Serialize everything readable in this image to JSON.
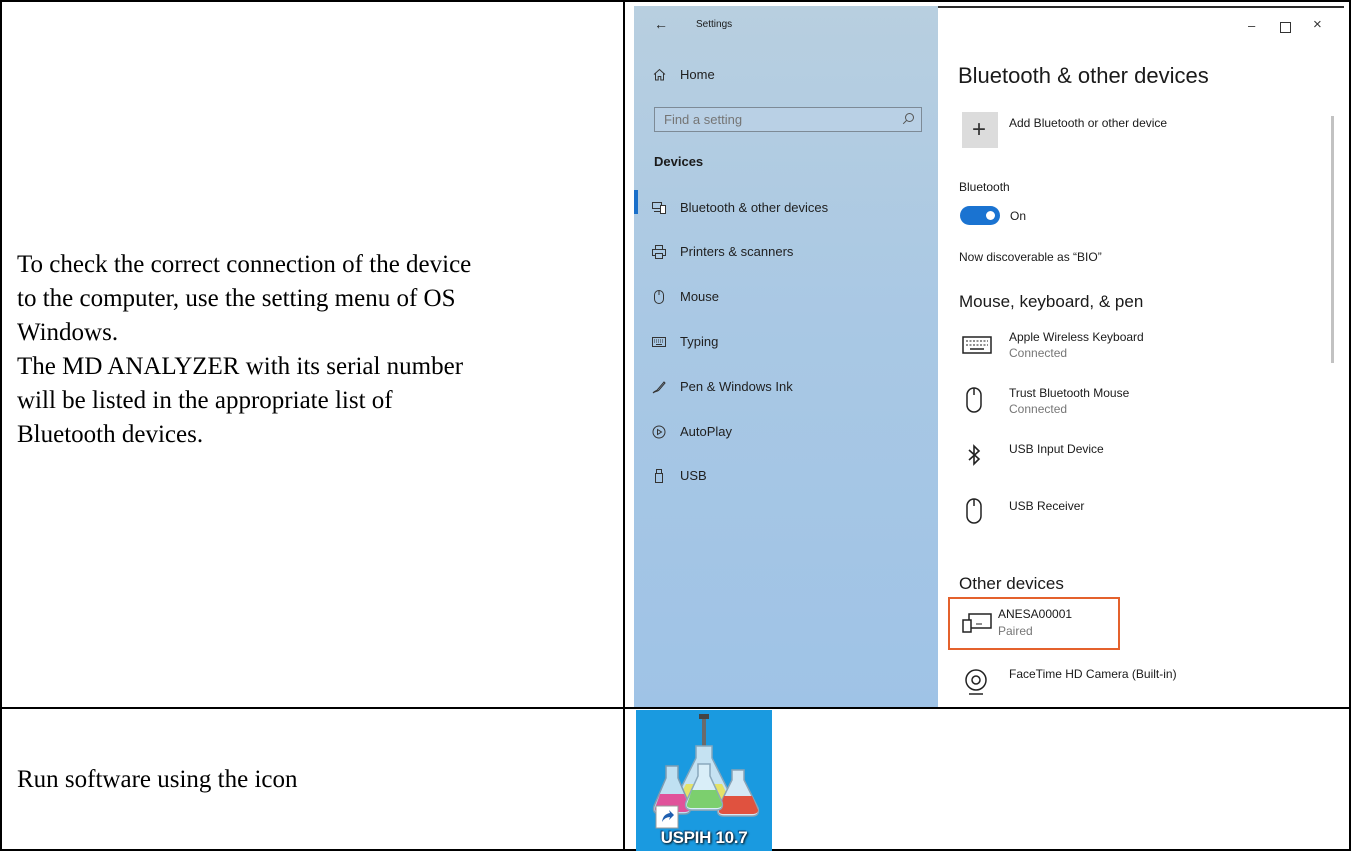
{
  "left_column": {
    "row1_lines": [
      "To check the correct connection of the device",
      "to the computer, use the setting menu of OS",
      "Windows.",
      "The MD ANALYZER with its serial number",
      "will be listed in the appropriate list of",
      "Bluetooth devices."
    ],
    "row2_text": "Run software using the icon"
  },
  "settings": {
    "title": "Settings",
    "back_icon": "back-arrow-icon",
    "window_controls": [
      "minimize-icon",
      "maximize-icon",
      "close-icon"
    ],
    "home": "Home",
    "search_placeholder": "Find a setting",
    "section": "Devices",
    "nav": [
      {
        "label": "Bluetooth & other devices",
        "icon": "bluetooth-devices-icon"
      },
      {
        "label": "Printers & scanners",
        "icon": "printer-icon"
      },
      {
        "label": "Mouse",
        "icon": "mouse-icon"
      },
      {
        "label": "Typing",
        "icon": "keyboard-icon"
      },
      {
        "label": "Pen & Windows Ink",
        "icon": "pen-icon"
      },
      {
        "label": "AutoPlay",
        "icon": "autoplay-icon"
      },
      {
        "label": "USB",
        "icon": "usb-icon"
      }
    ],
    "page_title": "Bluetooth & other devices",
    "add_device": "Add Bluetooth or other device",
    "bluetooth_label": "Bluetooth",
    "toggle_state": "On",
    "discoverable": "Now discoverable as “BIO”",
    "group_mkp": "Mouse, keyboard, & pen",
    "devices": [
      {
        "name": "Apple Wireless Keyboard",
        "status": "Connected",
        "icon": "keyboard-icon"
      },
      {
        "name": "Trust Bluetooth Mouse",
        "status": "Connected",
        "icon": "mouse-icon"
      },
      {
        "name": "USB Input Device",
        "status": "",
        "icon": "bluetooth-icon"
      },
      {
        "name": "USB Receiver",
        "status": "",
        "icon": "mouse-icon"
      }
    ],
    "group_other": "Other devices",
    "other_devices": [
      {
        "name": "ANESA00001",
        "status": "Paired",
        "icon": "device-icon"
      },
      {
        "name": "FaceTime HD Camera (Built-in)",
        "status": "",
        "icon": "webcam-icon"
      }
    ],
    "highlight_color": "#e4612c",
    "accent_color": "#1a73d1"
  },
  "shortcut": {
    "label": "USPIH 10.7",
    "background": "#1a9ae0"
  }
}
